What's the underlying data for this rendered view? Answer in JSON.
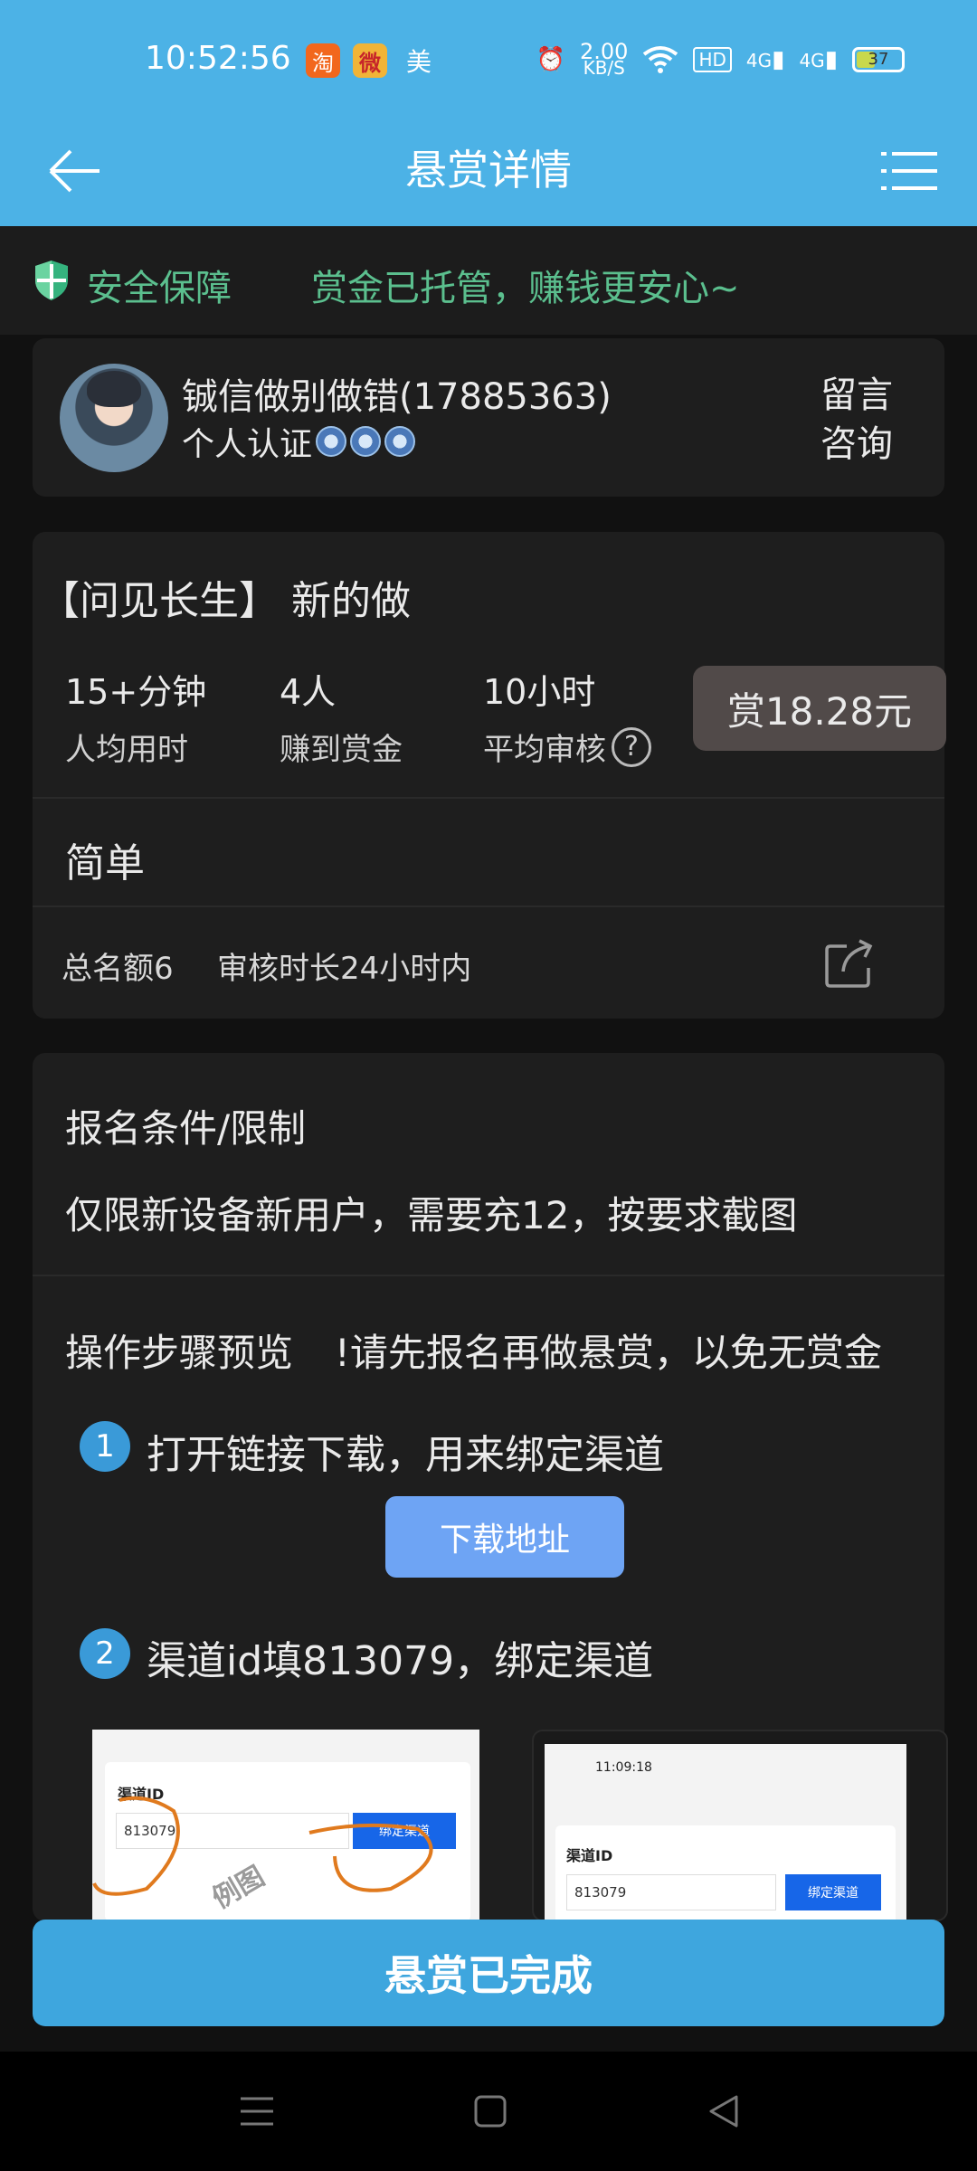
{
  "status_bar": {
    "time": "10:52:56",
    "app1": "淘",
    "app2": "微",
    "app3": "美",
    "speed_value": "2.00",
    "speed_unit": "KB/S",
    "hd": "HD",
    "net1": "4G",
    "net2": "4G",
    "battery": "37"
  },
  "header": {
    "title": "悬赏详情",
    "icons": [
      "back-arrow-icon",
      "menu-list-icon"
    ]
  },
  "safety": {
    "label": "安全保障",
    "note": "赏金已托管，赚钱更安心~",
    "accent": "#5bbf8e"
  },
  "publisher": {
    "name": "铖信做别做错(17885363)",
    "cert": "个人认证",
    "consult_label": "留言咨询"
  },
  "task": {
    "title": "【问见长生】 新的做",
    "stats": [
      {
        "value": "15+分钟",
        "label": "人均用时"
      },
      {
        "value": "4人",
        "label": "赚到赏金"
      },
      {
        "value": "10小时",
        "label": "平均审核"
      }
    ],
    "help_symbol": "?",
    "reward": "赏18.28元",
    "difficulty": "简单",
    "quota": "总名额6",
    "audit": "审核时长24小时内"
  },
  "conditions": {
    "title": "报名条件/限制",
    "text": "仅限新设备新用户，需要充12，按要求截图",
    "steps_title": "操作步骤预览",
    "steps_warning": "!请先报名再做悬赏，以免无赏金",
    "steps": [
      {
        "num": "1",
        "text": "打开链接下载，用来绑定渠道"
      },
      {
        "num": "2",
        "text": "渠道id填813079，绑定渠道"
      }
    ],
    "download_label": "下载地址",
    "screenshot1": {
      "label": "渠道ID",
      "input": "813079",
      "button": "绑定渠道",
      "watermark": "例图"
    },
    "screenshot2": {
      "status_time": "11:09:18",
      "label": "渠道ID",
      "input": "813079",
      "button": "绑定渠道"
    }
  },
  "complete_label": "悬赏已完成",
  "colors": {
    "header_bg": "#4cb2e6",
    "button_blue": "#3ea6de",
    "download_blue": "#6ea4f4",
    "reward_bg": "#514a49"
  }
}
